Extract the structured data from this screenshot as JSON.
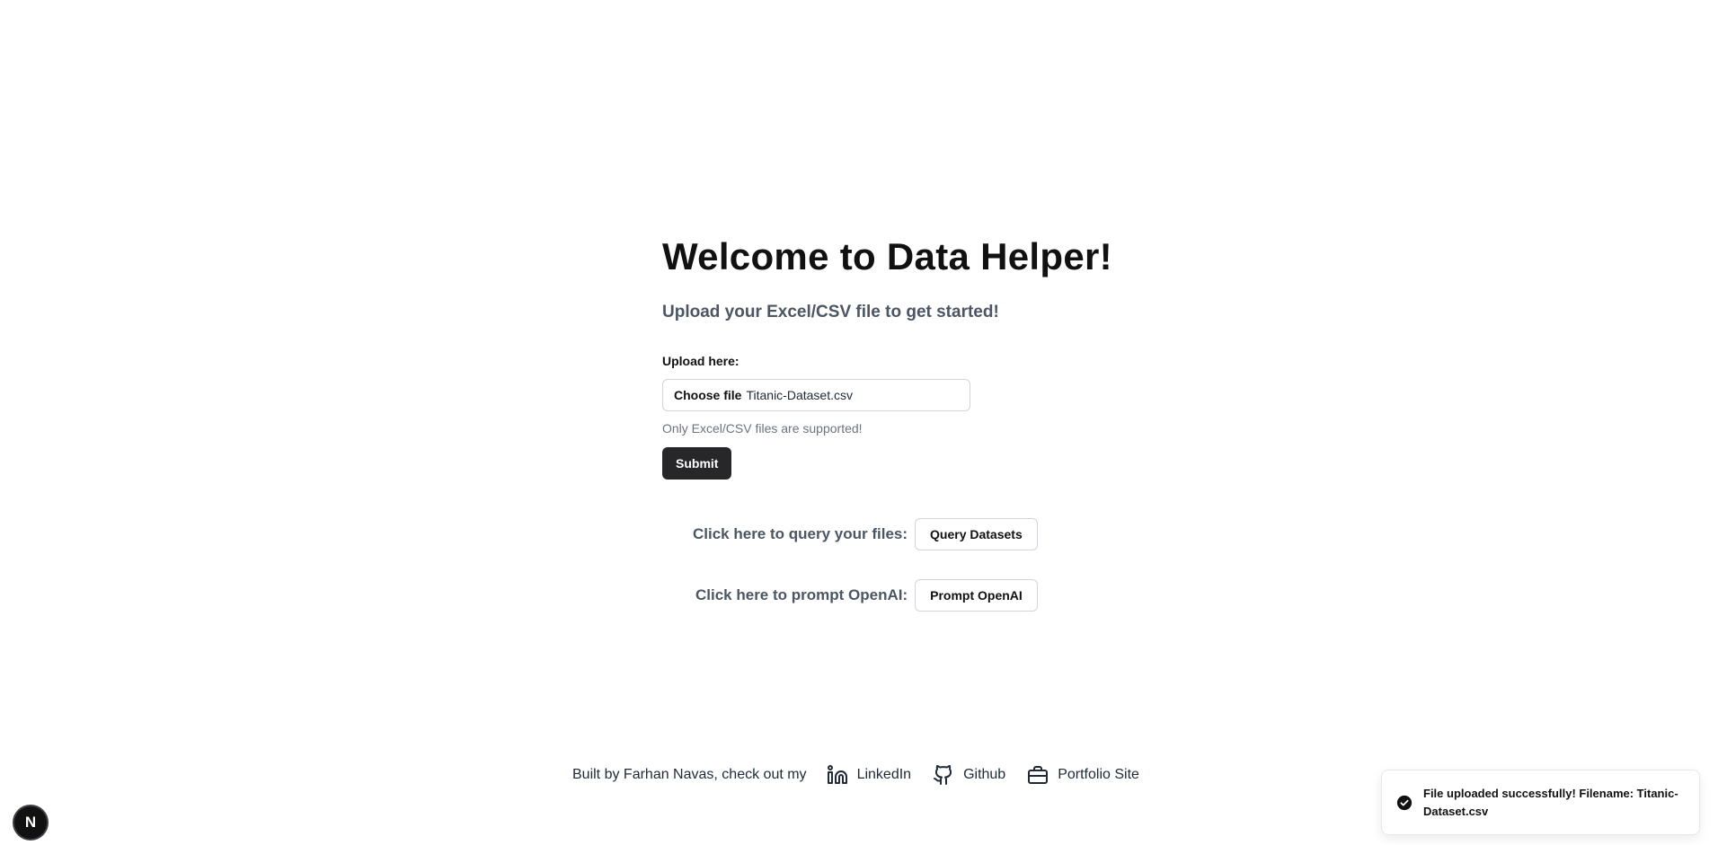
{
  "main": {
    "title": "Welcome to Data Helper!",
    "subtitle": "Upload your Excel/CSV file to get started!",
    "upload_label": "Upload here:",
    "file_input": {
      "button_label": "Choose file",
      "file_name": "Titanic-Dataset.csv"
    },
    "hint": "Only Excel/CSV files are supported!",
    "submit_label": "Submit"
  },
  "actions": {
    "query": {
      "label": "Click here to query your files:",
      "button": "Query Datasets"
    },
    "openai": {
      "label": "Click here to prompt OpenAI:",
      "button": "Prompt OpenAI"
    }
  },
  "footer": {
    "text": "Built by Farhan Navas, check out my",
    "links": [
      {
        "label": "LinkedIn",
        "icon": "linkedin-icon"
      },
      {
        "label": "Github",
        "icon": "github-icon"
      },
      {
        "label": "Portfolio Site",
        "icon": "briefcase-icon"
      }
    ]
  },
  "toast": {
    "message": "File uploaded successfully! Filename: Titanic-Dataset.csv",
    "icon": "check-circle-icon"
  },
  "dev_badge": {
    "label": "N",
    "icon": "nextjs-icon"
  },
  "colors": {
    "text_primary": "#111111",
    "text_secondary": "#4b5563",
    "hint": "#6b7280",
    "submit_bg": "#27272a",
    "border": "#d1d5db"
  }
}
